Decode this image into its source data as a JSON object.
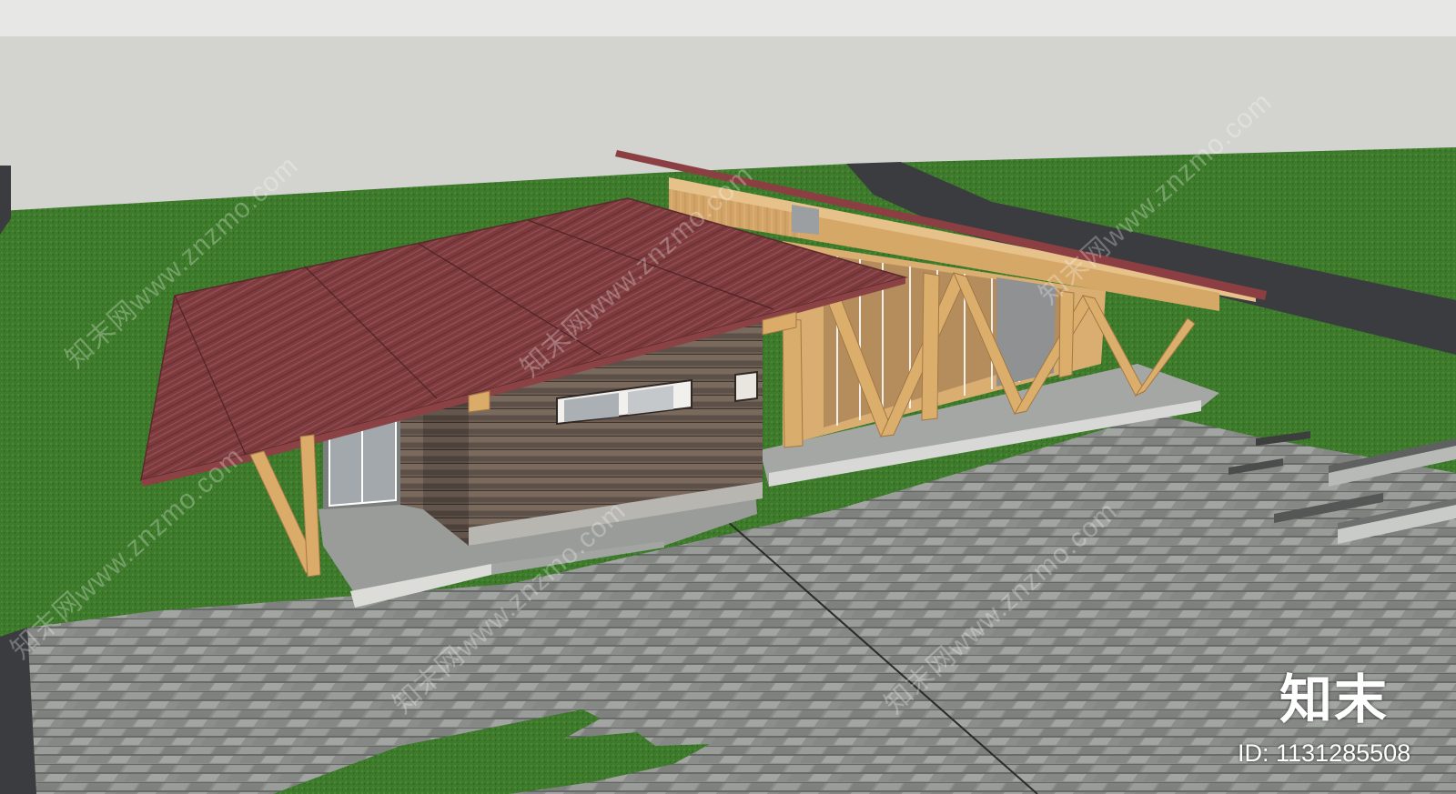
{
  "watermark": {
    "logo_text": "知末",
    "id_text": "ID: 1131285508",
    "tile_text": "知末网www.znzmo.com"
  },
  "colors": {
    "sky": "#d5d6d1",
    "grass": "#3f7a2c",
    "paving": "#8d8f8d",
    "roof": "#7a3a3c",
    "wood_frame": "#d7a866",
    "siding": "#6f6056",
    "road": "#3b3d40"
  }
}
